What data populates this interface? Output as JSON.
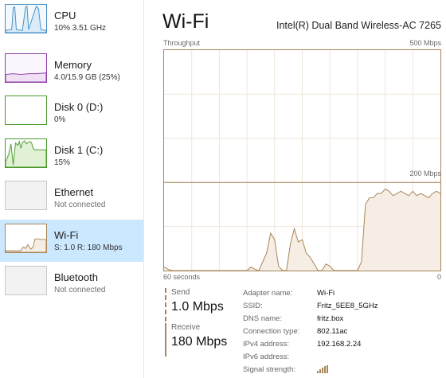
{
  "sidebar": {
    "items": [
      {
        "name": "CPU",
        "sub": "10%  3.51 GHz",
        "status": "active"
      },
      {
        "name": "Memory",
        "sub": "4.0/15.9 GB (25%)",
        "status": "active"
      },
      {
        "name": "Disk 0 (D:)",
        "sub": "0%",
        "status": "active"
      },
      {
        "name": "Disk 1 (C:)",
        "sub": "15%",
        "status": "active"
      },
      {
        "name": "Ethernet",
        "sub": "Not connected",
        "status": "inactive"
      },
      {
        "name": "Wi-Fi",
        "sub": "S: 1.0  R: 180 Mbps",
        "status": "selected"
      },
      {
        "name": "Bluetooth",
        "sub": "Not connected",
        "status": "inactive"
      }
    ]
  },
  "main": {
    "title": "Wi-Fi",
    "adapter": "Intel(R) Dual Band Wireless-AC 7265",
    "graph": {
      "label": "Throughput",
      "max_label": "500 Mbps",
      "mid_label": "200 Mbps",
      "x_left_label": "60 seconds",
      "x_right_label": "0"
    },
    "send": {
      "label": "Send",
      "value": "1.0 Mbps"
    },
    "receive": {
      "label": "Receive",
      "value": "180 Mbps"
    },
    "properties": [
      {
        "key": "Adapter name:",
        "value": "Wi-Fi"
      },
      {
        "key": "SSID:",
        "value": "Fritz_5EE8_5GHz"
      },
      {
        "key": "DNS name:",
        "value": "fritz.box"
      },
      {
        "key": "Connection type:",
        "value": "802.11ac"
      },
      {
        "key": "IPv4 address:",
        "value": "192.168.2.24"
      },
      {
        "key": "IPv6 address:",
        "value": ""
      },
      {
        "key": "Signal strength:",
        "value": ""
      }
    ]
  },
  "chart_data": {
    "type": "area",
    "title": "Throughput",
    "xlabel": "60 seconds",
    "ylabel": "",
    "x": [
      60,
      59,
      58,
      57,
      56,
      55,
      54,
      53,
      52,
      51,
      50,
      49,
      48,
      47,
      46,
      45,
      44,
      43,
      42,
      41,
      40,
      39,
      38,
      37,
      36,
      35,
      34,
      33,
      32,
      31,
      30,
      29,
      28,
      27,
      26,
      25,
      24,
      23,
      22,
      21,
      20,
      19,
      18,
      17,
      16,
      15,
      14,
      13,
      12,
      11,
      10,
      9,
      8,
      7,
      6,
      5,
      4,
      3,
      2,
      1,
      0
    ],
    "xlim": [
      60,
      0
    ],
    "ylim": [
      0,
      500
    ],
    "reference_lines": [
      200
    ],
    "series": [
      {
        "values": [
          8,
          3,
          0,
          0,
          0,
          0,
          0,
          0,
          0,
          0,
          0,
          0,
          0,
          0,
          0,
          0,
          0,
          0,
          0,
          0,
          0,
          0,
          8,
          3,
          0,
          20,
          40,
          85,
          70,
          10,
          0,
          0,
          60,
          95,
          65,
          70,
          40,
          30,
          15,
          0,
          0,
          15,
          10,
          0,
          0,
          0,
          0,
          0,
          0,
          0,
          20,
          150,
          165,
          165,
          175,
          175,
          185,
          180,
          170,
          175,
          180,
          175,
          170,
          180,
          170,
          175,
          170,
          165,
          175,
          180,
          175
        ]
      }
    ]
  },
  "colors": {
    "accent": "#a7865a",
    "fill": "#f6ede4",
    "selected": "#cce8ff"
  }
}
